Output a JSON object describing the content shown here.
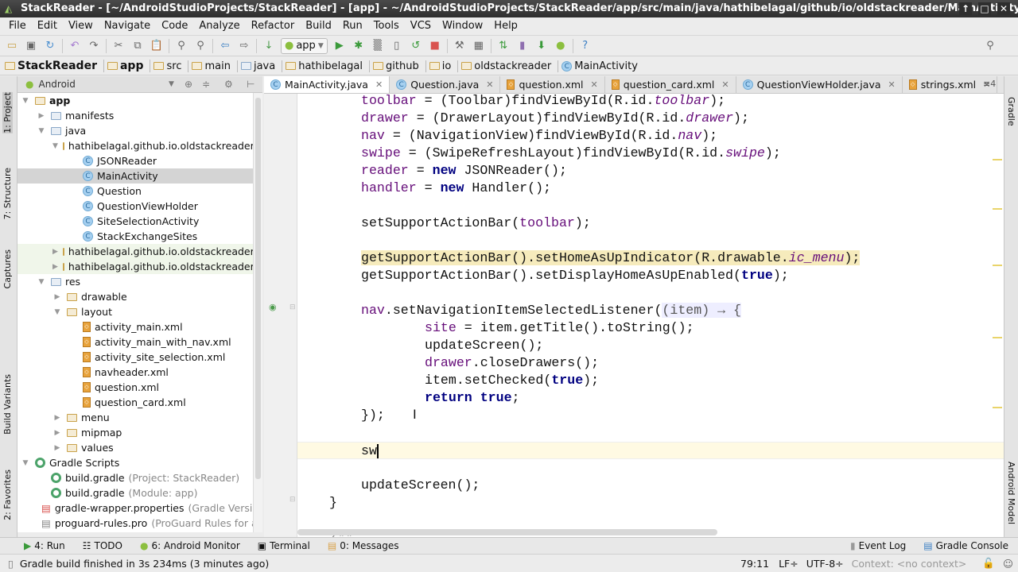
{
  "window": {
    "title": "StackReader - [~/AndroidStudioProjects/StackReader] - [app] - ~/AndroidStudioProjects/StackReader/app/src/main/java/hathibelagal/github/io/oldstackreader/MainActivity.java - Android Studio",
    "min": "↑",
    "max": "□",
    "close": "✕"
  },
  "menu": [
    "File",
    "Edit",
    "View",
    "Navigate",
    "Code",
    "Analyze",
    "Refactor",
    "Build",
    "Run",
    "Tools",
    "VCS",
    "Window",
    "Help"
  ],
  "toolbar": {
    "run_config": "app"
  },
  "breadcrumb": [
    "StackReader",
    "app",
    "src",
    "main",
    "java",
    "hathibelagal",
    "github",
    "io",
    "oldstackreader",
    "MainActivity"
  ],
  "project_panel": {
    "view": "Android",
    "tree": [
      {
        "label": "app",
        "depth": 0,
        "arrow": "▼",
        "icon": "module",
        "bold": true
      },
      {
        "label": "manifests",
        "depth": 1,
        "arrow": "▶",
        "icon": "folder"
      },
      {
        "label": "java",
        "depth": 1,
        "arrow": "▼",
        "icon": "folder"
      },
      {
        "label": "hathibelagal.github.io.oldstackreader",
        "depth": 2,
        "arrow": "▼",
        "icon": "package"
      },
      {
        "label": "JSONReader",
        "depth": 3,
        "icon": "class"
      },
      {
        "label": "MainActivity",
        "depth": 3,
        "icon": "class",
        "selected": true
      },
      {
        "label": "Question",
        "depth": 3,
        "icon": "class"
      },
      {
        "label": "QuestionViewHolder",
        "depth": 3,
        "icon": "class"
      },
      {
        "label": "SiteSelectionActivity",
        "depth": 3,
        "icon": "class"
      },
      {
        "label": "StackExchangeSites",
        "depth": 3,
        "icon": "class"
      },
      {
        "label": "hathibelagal.github.io.oldstackreader",
        "depth": 2,
        "arrow": "▶",
        "icon": "package",
        "test": true
      },
      {
        "label": "hathibelagal.github.io.oldstackreader",
        "depth": 2,
        "arrow": "▶",
        "icon": "package",
        "test": true
      },
      {
        "label": "res",
        "depth": 1,
        "arrow": "▼",
        "icon": "folder"
      },
      {
        "label": "drawable",
        "depth": 2,
        "arrow": "▶",
        "icon": "package"
      },
      {
        "label": "layout",
        "depth": 2,
        "arrow": "▼",
        "icon": "package"
      },
      {
        "label": "activity_main.xml",
        "depth": 3,
        "icon": "xml"
      },
      {
        "label": "activity_main_with_nav.xml",
        "depth": 3,
        "icon": "xml"
      },
      {
        "label": "activity_site_selection.xml",
        "depth": 3,
        "icon": "xml"
      },
      {
        "label": "navheader.xml",
        "depth": 3,
        "icon": "xml"
      },
      {
        "label": "question.xml",
        "depth": 3,
        "icon": "xml"
      },
      {
        "label": "question_card.xml",
        "depth": 3,
        "icon": "xml"
      },
      {
        "label": "menu",
        "depth": 2,
        "arrow": "▶",
        "icon": "package"
      },
      {
        "label": "mipmap",
        "depth": 2,
        "arrow": "▶",
        "icon": "package"
      },
      {
        "label": "values",
        "depth": 2,
        "arrow": "▶",
        "icon": "package"
      },
      {
        "label": "Gradle Scripts",
        "depth": 0,
        "arrow": "▼",
        "icon": "gradle"
      },
      {
        "label": "build.gradle",
        "depth": 1,
        "icon": "gradle",
        "hint": "(Project: StackReader)"
      },
      {
        "label": "build.gradle",
        "depth": 1,
        "icon": "gradle",
        "hint": "(Module: app)"
      },
      {
        "label": "gradle-wrapper.properties",
        "depth": 1,
        "icon": "props",
        "hint": "(Gradle Version)"
      },
      {
        "label": "proguard-rules.pro",
        "depth": 1,
        "icon": "file",
        "hint": "(ProGuard Rules for app)"
      }
    ]
  },
  "left_stripe": [
    "1: Project",
    "7: Structure",
    "Captures",
    "Build Variants",
    "2: Favorites"
  ],
  "right_stripe": [
    "Gradle",
    "Android Model"
  ],
  "tabs": [
    {
      "label": "MainActivity.java",
      "icon": "class",
      "active": true
    },
    {
      "label": "Question.java",
      "icon": "class"
    },
    {
      "label": "question.xml",
      "icon": "xml"
    },
    {
      "label": "question_card.xml",
      "icon": "xml"
    },
    {
      "label": "QuestionViewHolder.java",
      "icon": "class"
    },
    {
      "label": "strings.xml",
      "icon": "xml"
    }
  ],
  "tabs_overflow": "≡4",
  "code": [
    [
      [
        0,
        [
          [
            "toolbar",
            "f"
          ],
          [
            " = (Toolbar)findViewById(R.id.",
            ""
          ],
          [
            "toolbar",
            "i"
          ],
          [
            ");",
            ""
          ]
        ]
      ]
    ],
    [
      [
        0,
        [
          [
            "drawer",
            "f"
          ],
          [
            " = (DrawerLayout)findViewById(R.id.",
            ""
          ],
          [
            "drawer",
            "i"
          ],
          [
            ");",
            ""
          ]
        ]
      ]
    ],
    [
      [
        0,
        [
          [
            "nav",
            "f"
          ],
          [
            " = (NavigationView)findViewById(R.id.",
            ""
          ],
          [
            "nav",
            "i"
          ],
          [
            ");",
            ""
          ]
        ]
      ]
    ],
    [
      [
        0,
        [
          [
            "swipe",
            "f"
          ],
          [
            " = (SwipeRefreshLayout)findViewById(R.id.",
            ""
          ],
          [
            "swipe",
            "i"
          ],
          [
            ");",
            ""
          ]
        ]
      ]
    ],
    [
      [
        0,
        [
          [
            "reader",
            "f"
          ],
          [
            " = ",
            ""
          ],
          [
            "new",
            "k"
          ],
          [
            " JSONReader();",
            ""
          ]
        ]
      ]
    ],
    [
      [
        0,
        [
          [
            "handler",
            "f"
          ],
          [
            " = ",
            ""
          ],
          [
            "new",
            "k"
          ],
          [
            " Handler();",
            ""
          ]
        ]
      ]
    ],
    [
      [
        0,
        []
      ]
    ],
    [
      [
        0,
        [
          [
            "setSupportActionBar(",
            ""
          ],
          [
            "toolbar",
            "f"
          ],
          [
            ");",
            ""
          ]
        ]
      ]
    ],
    [
      [
        0,
        []
      ]
    ],
    [
      [
        0,
        [
          [
            "getSupportActionBar().setHomeAsUpIndicator(R.drawable.",
            "w"
          ],
          [
            "ic_menu",
            "i w"
          ],
          [
            ");",
            "w"
          ]
        ]
      ],
      "warn"
    ],
    [
      [
        0,
        [
          [
            "getSupportActionBar().setDisplayHomeAsUpEnabled(",
            ""
          ],
          [
            "true",
            "k"
          ],
          [
            ");",
            ""
          ]
        ]
      ]
    ],
    [
      [
        0,
        []
      ]
    ],
    [
      [
        0,
        [
          [
            "nav",
            "f"
          ],
          [
            ".setNavigationItemSelectedListener(",
            ""
          ],
          [
            "(item) → {",
            "lam"
          ]
        ]
      ]
    ],
    [
      [
        1,
        [
          [
            "site",
            "f"
          ],
          [
            " = item.getTitle().toString();",
            ""
          ]
        ]
      ]
    ],
    [
      [
        1,
        [
          [
            "updateScreen();",
            ""
          ]
        ]
      ]
    ],
    [
      [
        1,
        [
          [
            "drawer",
            "f"
          ],
          [
            ".closeDrawers();",
            ""
          ]
        ]
      ]
    ],
    [
      [
        1,
        [
          [
            "item.setChecked(",
            ""
          ],
          [
            "true",
            "k"
          ],
          [
            ");",
            ""
          ]
        ]
      ]
    ],
    [
      [
        1,
        [
          [
            "return true",
            "k"
          ],
          [
            ";",
            ""
          ]
        ]
      ]
    ],
    [
      [
        0,
        [
          [
            "});",
            ""
          ]
        ]
      ]
    ],
    [
      [
        0,
        []
      ]
    ],
    [
      [
        0,
        [
          [
            "sw",
            ""
          ]
        ]
      ],
      "cur"
    ],
    [
      [
        0,
        []
      ]
    ],
    [
      [
        0,
        [
          [
            "updateScreen();",
            ""
          ]
        ]
      ]
    ],
    [
      [
        -1,
        [
          [
            "}",
            ""
          ]
        ]
      ]
    ],
    [
      [
        0,
        []
      ]
    ],
    [
      [
        -1,
        [
          [
            "/**",
            "c"
          ]
        ]
      ]
    ]
  ],
  "bottom_tools": [
    {
      "label": "4: Run",
      "icon": "run"
    },
    {
      "label": "TODO",
      "icon": "todo"
    },
    {
      "label": "6: Android Monitor",
      "icon": "android"
    },
    {
      "label": "Terminal",
      "icon": "terminal"
    },
    {
      "label": "0: Messages",
      "icon": "messages"
    }
  ],
  "bottom_right": [
    {
      "label": "Event Log"
    },
    {
      "label": "Gradle Console"
    }
  ],
  "status": {
    "message": "Gradle build finished in 3s 234ms (3 minutes ago)",
    "position": "79:11",
    "line_sep": "LF÷",
    "encoding": "UTF-8÷",
    "context": "Context: <no context>"
  }
}
